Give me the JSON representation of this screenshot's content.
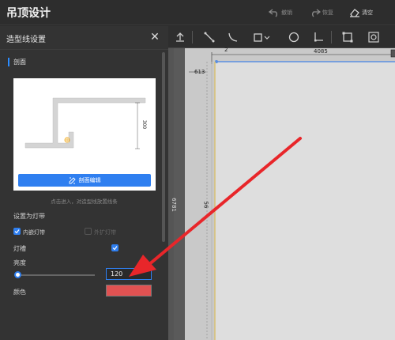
{
  "app": {
    "title": "吊顶设计"
  },
  "top_actions": {
    "undo": "撤销",
    "redo": "恢复",
    "clear": "清空"
  },
  "panel": {
    "title": "造型线设置",
    "section_title": "剖面",
    "preview_dimension": "300",
    "edit_button": "剖面编辑",
    "hint": "点击进入，对造型线放置线条",
    "lamp_section_label": "设置为灯带",
    "inner_lamp_label": "内嵌灯带",
    "inner_lamp_checked": true,
    "outer_lamp_label": "外扩灯带",
    "outer_lamp_checked": false,
    "slot_label": "灯槽",
    "slot_checked": true,
    "brightness_label": "亮度",
    "brightness_value": "120",
    "brightness_fraction": 0.05,
    "color_label": "颜色",
    "color_value": "#e05252"
  },
  "canvas": {
    "dim_top": "4085",
    "dim_offset": "613",
    "dim_top_small": "2",
    "dim_left": "6781",
    "dim_inner": "56"
  },
  "colors": {
    "accent": "#2f7ff0",
    "arrow": "#e8262a"
  }
}
